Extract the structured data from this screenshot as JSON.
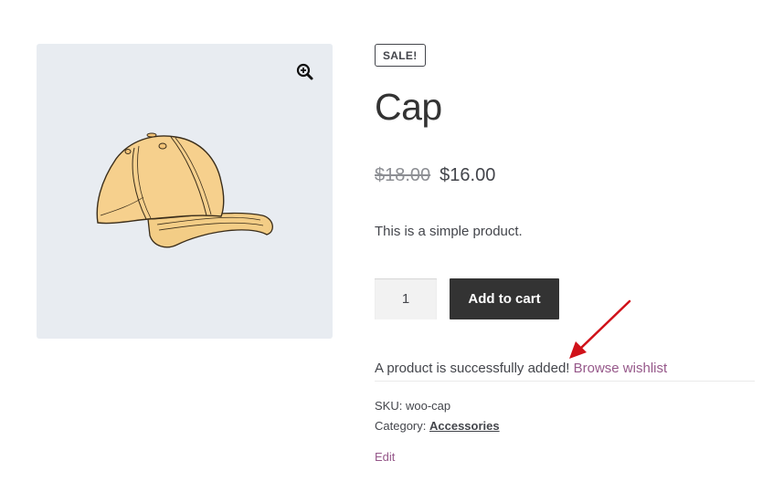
{
  "gallery": {
    "zoom_icon": "magnifier-plus-icon",
    "image_alt": "Cap"
  },
  "product": {
    "sale_badge": "SALE!",
    "title": "Cap",
    "price_regular": "$18.00",
    "price_sale": "$16.00",
    "description": "This is a simple product.",
    "quantity": "1",
    "add_to_cart_label": "Add to cart"
  },
  "wishlist": {
    "message": "A product is successfully added!",
    "link_label": "Browse wishlist"
  },
  "meta": {
    "sku_label": "SKU:",
    "sku_value": "woo-cap",
    "category_label": "Category:",
    "category_value": "Accessories",
    "edit_label": "Edit"
  },
  "annotation": {
    "arrow_color": "#d0121a"
  },
  "colors": {
    "link": "#96588a",
    "button_bg": "#333333",
    "text": "#43454b",
    "gallery_bg": "#e8ecf1"
  }
}
